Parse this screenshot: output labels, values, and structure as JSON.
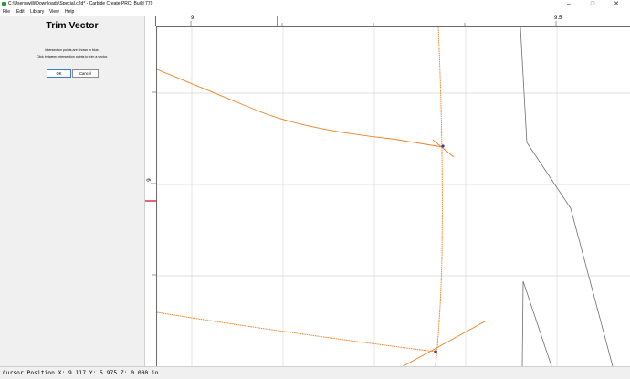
{
  "window": {
    "title": "C:\\Users\\willi\\Downloads\\Special.c2d* - Carbide Create PRO: Build 779",
    "minimize_icon": "minimize-icon",
    "maximize_icon": "maximize-icon",
    "close_icon": "close-icon"
  },
  "menu": {
    "items": [
      "File",
      "Edit",
      "Library",
      "View",
      "Help"
    ]
  },
  "panel": {
    "title": "Trim Vector",
    "line1": "Intersection points are shown in blue.",
    "line2": "Click between intersection points to trim a vector.",
    "ok_label": "OK",
    "cancel_label": "Cancel"
  },
  "rulers": {
    "top_labels": [
      "9",
      "9.5"
    ],
    "left_label": "6",
    "cursor_marker_color": "#e0203a"
  },
  "canvas": {
    "selected_color": "#f07f22",
    "path_color": "#6e6e6e",
    "grid_color": "#d9d9d9",
    "intersection_color": "#3b3b9e"
  },
  "status": {
    "text": "Cursor Position X: 9.117 Y: 5.975 Z: 0.000 in"
  }
}
